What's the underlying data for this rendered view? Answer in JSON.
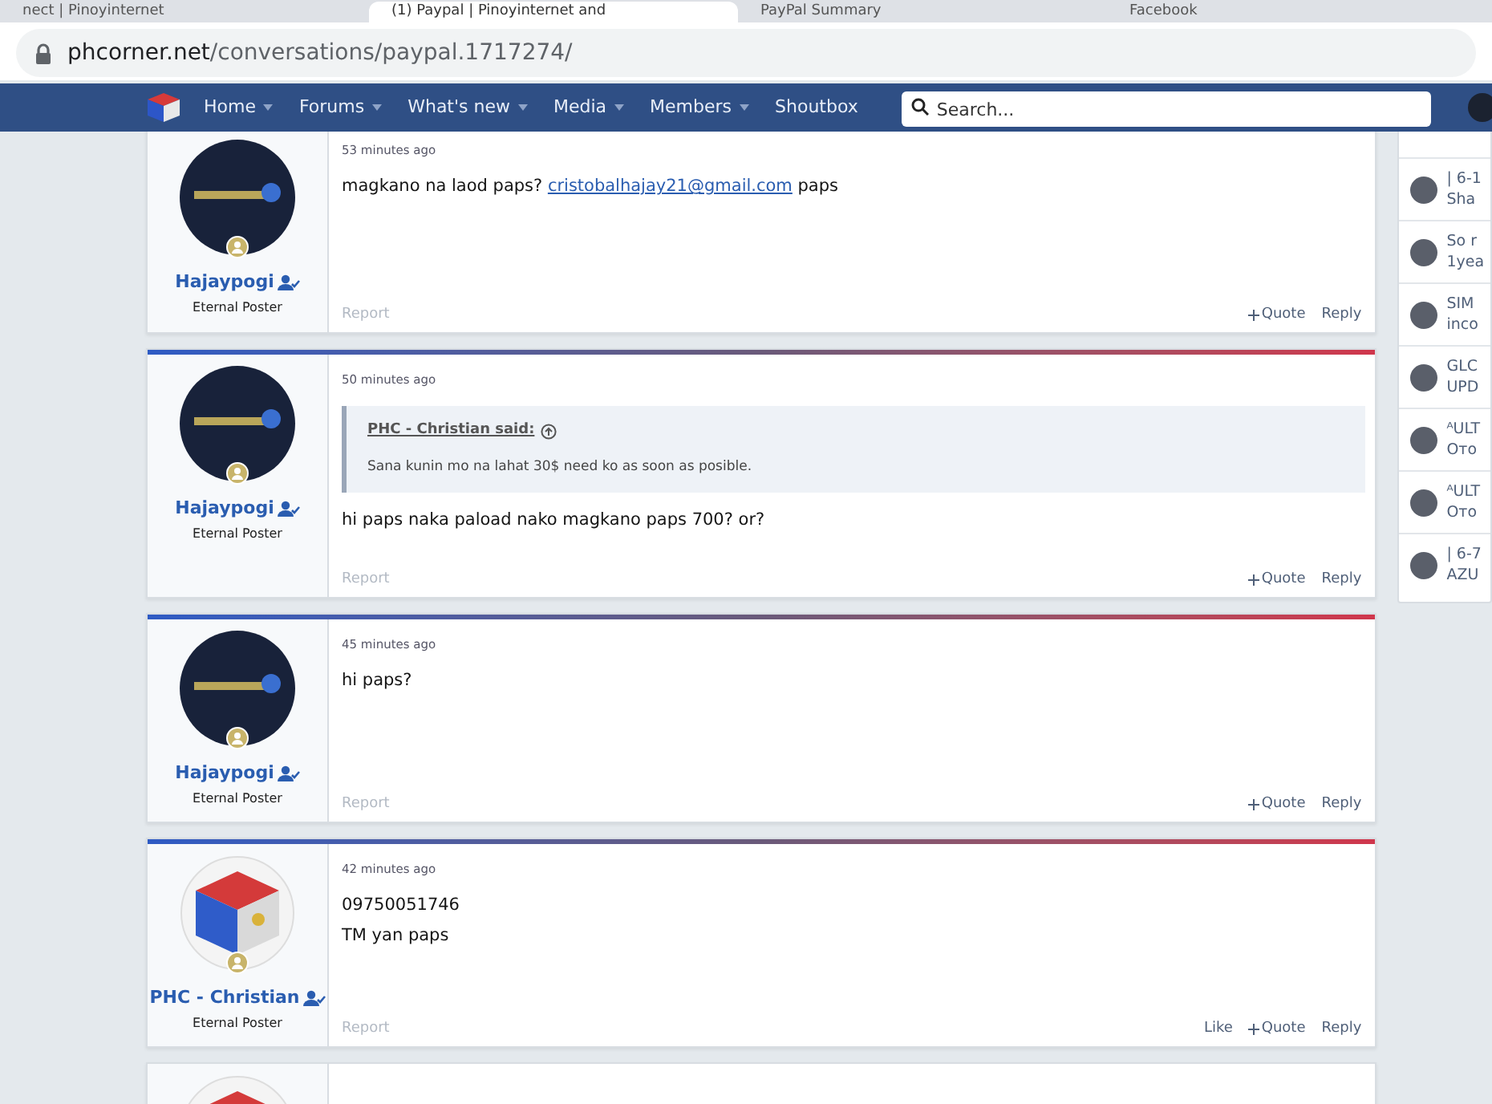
{
  "browser": {
    "tabs": [
      {
        "label": "nect | Pinoyinternet",
        "selected": false
      },
      {
        "label": "(1) Paypal | Pinoyinternet and",
        "selected": true
      },
      {
        "label": "PayPal Summary",
        "selected": false
      },
      {
        "label": "Facebook",
        "selected": false
      }
    ],
    "url": {
      "domain": "phcorner.net",
      "path": "/conversations/paypal.1717274/"
    }
  },
  "nav": {
    "items": [
      {
        "label": "Home",
        "has_menu": true
      },
      {
        "label": "Forums",
        "has_menu": true
      },
      {
        "label": "What's new",
        "has_menu": true
      },
      {
        "label": "Media",
        "has_menu": true
      },
      {
        "label": "Members",
        "has_menu": true
      },
      {
        "label": "Shoutbox",
        "has_menu": false
      }
    ],
    "search": {
      "placeholder": "Search..."
    }
  },
  "posts": [
    {
      "partial": false,
      "avatar": {
        "kind": "dark"
      },
      "username": "Hajaypogi",
      "user_title": "Eternal Poster",
      "time": "53 minutes ago",
      "lines": [
        [
          {
            "text": "magkano na laod paps? "
          },
          {
            "text": "cristobalhajay21@gmail.com",
            "link": true
          },
          {
            "text": " paps"
          }
        ]
      ],
      "report": "Report",
      "actions": [
        {
          "kind": "quote",
          "label": "Quote"
        },
        {
          "kind": "reply",
          "label": "Reply"
        }
      ]
    },
    {
      "partial": false,
      "avatar": {
        "kind": "dark"
      },
      "username": "Hajaypogi",
      "user_title": "Eternal Poster",
      "time": "50 minutes ago",
      "quote": {
        "author": "PHC - Christian said:",
        "text": "Sana kunin mo na lahat 30$ need ko as soon as posible."
      },
      "lines": [
        [
          {
            "text": "hi paps naka paload nako magkano paps 700? or?"
          }
        ]
      ],
      "report": "Report",
      "actions": [
        {
          "kind": "quote",
          "label": "Quote"
        },
        {
          "kind": "reply",
          "label": "Reply"
        }
      ]
    },
    {
      "partial": false,
      "avatar": {
        "kind": "dark"
      },
      "username": "Hajaypogi",
      "user_title": "Eternal Poster",
      "time": "45 minutes ago",
      "lines": [
        [
          {
            "text": "hi paps?"
          }
        ]
      ],
      "report": "Report",
      "actions": [
        {
          "kind": "quote",
          "label": "Quote"
        },
        {
          "kind": "reply",
          "label": "Reply"
        }
      ]
    },
    {
      "partial": false,
      "avatar": {
        "kind": "flag"
      },
      "username": "PHC - Christian",
      "user_title": "Eternal Poster",
      "time": "42 minutes ago",
      "lines": [
        [
          {
            "text": "09750051746"
          }
        ],
        [
          {
            "text": "TM yan paps"
          }
        ]
      ],
      "report": "Report",
      "actions": [
        {
          "kind": "like",
          "label": "Like"
        },
        {
          "kind": "quote",
          "label": "Quote"
        },
        {
          "kind": "reply",
          "label": "Reply"
        }
      ]
    },
    {
      "partial": true,
      "avatar": {
        "kind": "flag"
      }
    }
  ],
  "sidebar": {
    "items": [
      {
        "line1": "| 6-1",
        "line2": "Sha"
      },
      {
        "line1": "So r",
        "line2": "1yea"
      },
      {
        "line1": "SIM",
        "line2": "inco"
      },
      {
        "line1": "GLC",
        "line2": "UPD"
      },
      {
        "line1": "ᴬULT",
        "line2": "Ото"
      },
      {
        "line1": "ᴬULT",
        "line2": "Ото"
      },
      {
        "line1": "| 6-7",
        "line2": "AZU"
      }
    ]
  }
}
